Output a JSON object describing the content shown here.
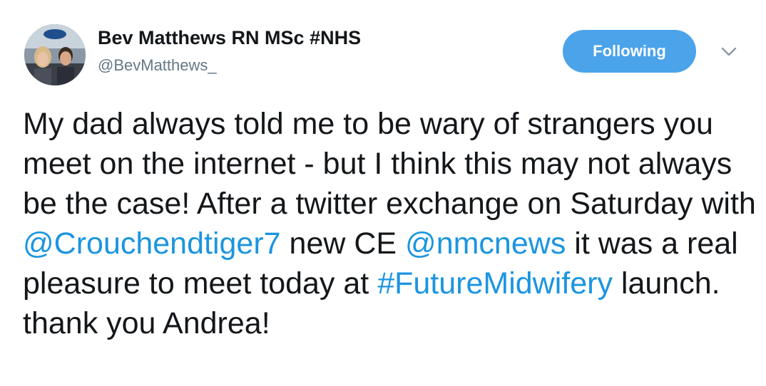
{
  "user": {
    "display_name": "Bev Matthews RN MSc #NHS",
    "handle": "@BevMatthews_"
  },
  "actions": {
    "follow_label": "Following",
    "menu_icon": "chevron-down-icon"
  },
  "tweet": {
    "text_1": "My dad always told me to be wary of strangers you meet on the internet - but I think this may not always be the case! After a twitter exchange on Saturday with ",
    "mention_1": "@Crouchendtiger7",
    "text_2": " new CE ",
    "mention_2": "@nmcnews",
    "text_3": " it was a real pleasure to meet today at ",
    "hashtag_1": "#FutureMidwifery",
    "text_4": " launch. thank you Andrea!"
  },
  "colors": {
    "accent": "#4ba3ea",
    "link": "#1b95e0",
    "text": "#14171a",
    "muted": "#657786"
  }
}
